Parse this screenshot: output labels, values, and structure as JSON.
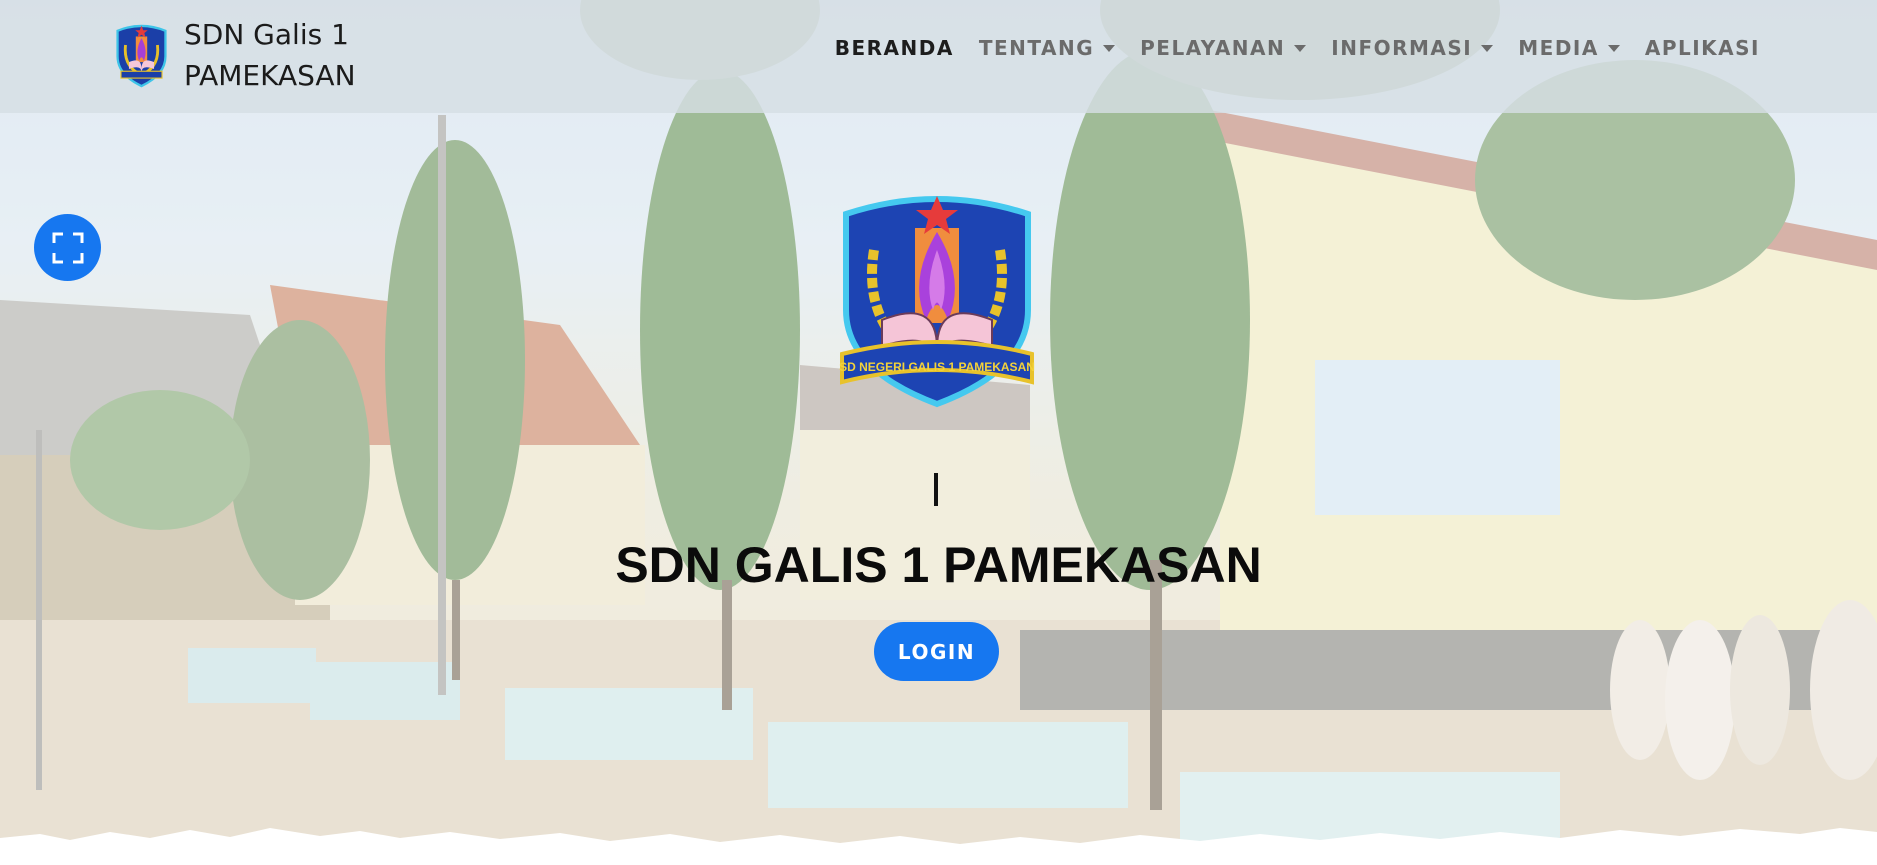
{
  "brand": {
    "line1": "SDN Galis 1",
    "line2": "PAMEKASAN",
    "logo_icon": "school-emblem-icon"
  },
  "nav": {
    "items": [
      {
        "label": "BERANDA",
        "active": true,
        "dropdown": false
      },
      {
        "label": "TENTANG",
        "active": false,
        "dropdown": true
      },
      {
        "label": "PELAYANAN",
        "active": false,
        "dropdown": true
      },
      {
        "label": "INFORMASI",
        "active": false,
        "dropdown": true
      },
      {
        "label": "MEDIA",
        "active": false,
        "dropdown": true
      },
      {
        "label": "APLIKASI",
        "active": false,
        "dropdown": false
      }
    ]
  },
  "hero": {
    "typed_text": "I",
    "title": "SDN GALIS 1 PAMEKASAN",
    "login_label": "LOGIN",
    "fullscreen_icon": "fullscreen-icon",
    "emblem_icon": "school-emblem-icon",
    "emblem_ribbon_text": "SD NEGERI GALIS 1 PAMEKASAN"
  },
  "colors": {
    "accent": "#1677f0",
    "nav_active": "#1d1d1d",
    "nav_text": "#6b6b6b",
    "title": "#0b0b0b"
  }
}
